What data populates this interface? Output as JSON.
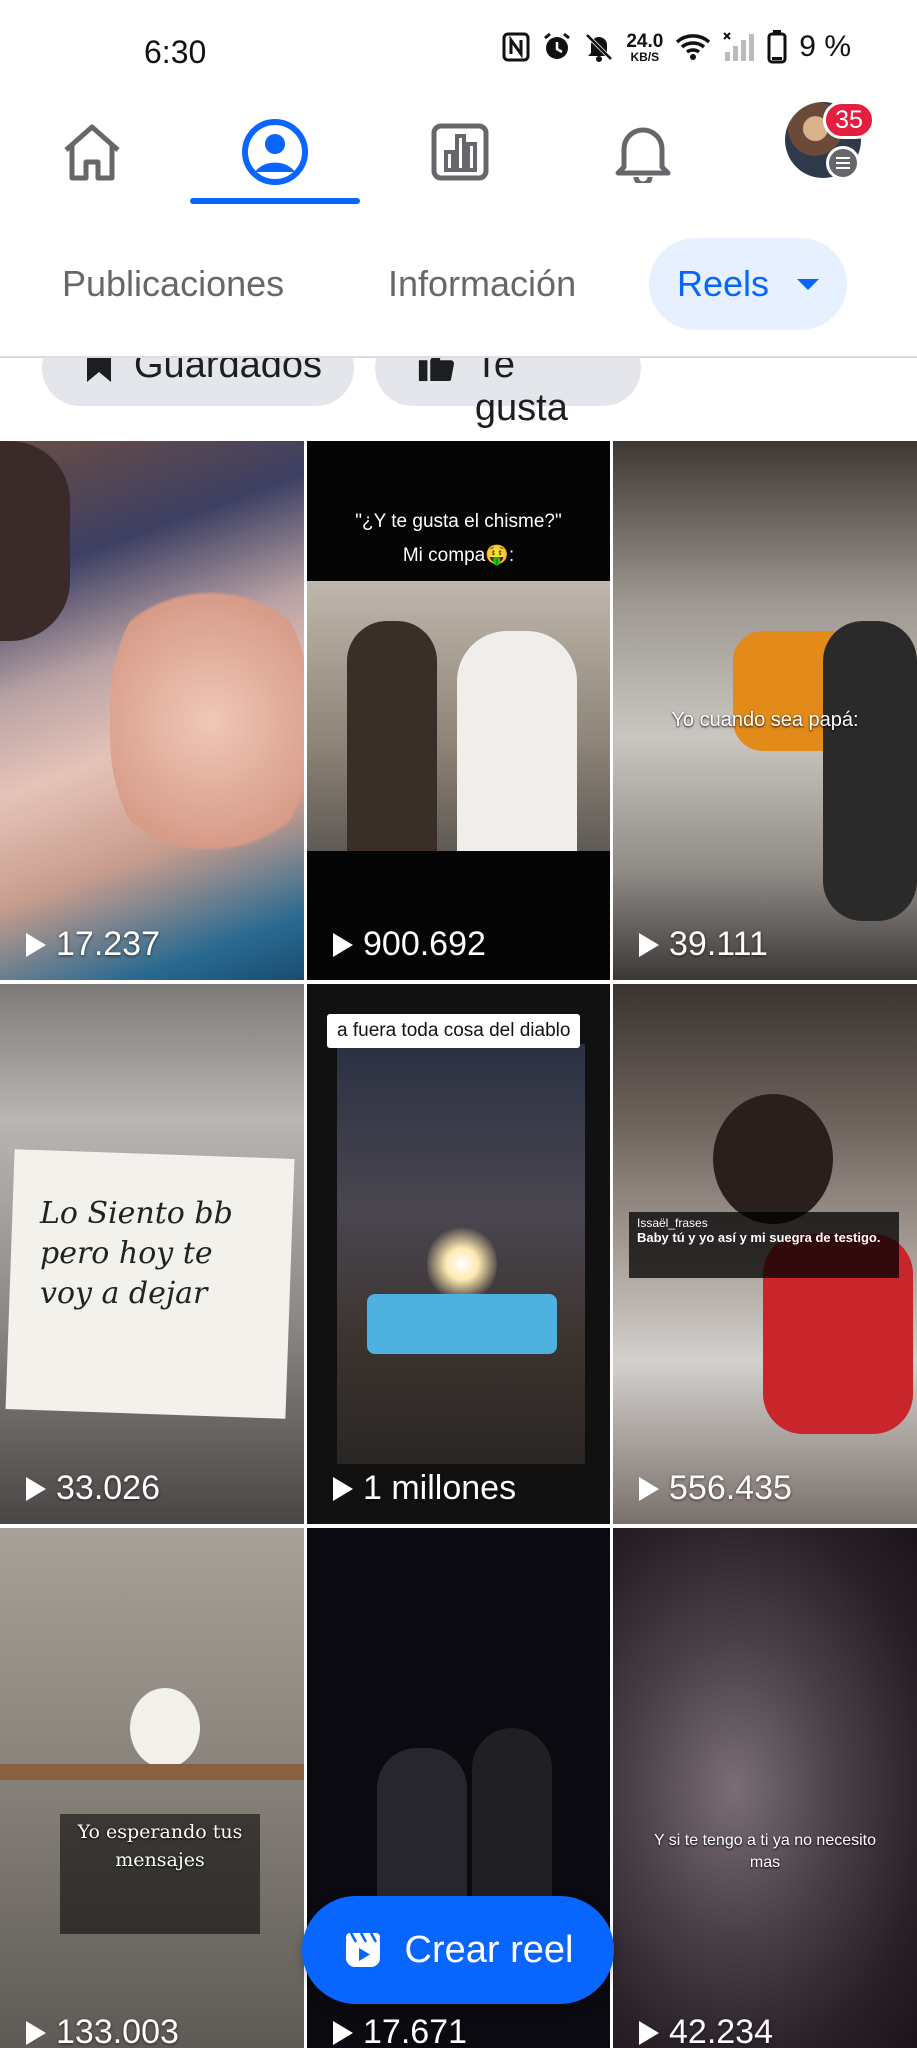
{
  "status_bar": {
    "time": "6:30",
    "net_speed_value": "24.0",
    "net_speed_unit": "KB/S",
    "battery_text": "9 %"
  },
  "nav": {
    "notifications_badge": "35",
    "accent_color": "#0866ff",
    "badge_color": "#e41e3f"
  },
  "tabs": {
    "posts": "Publicaciones",
    "info": "Información",
    "reels": "Reels"
  },
  "filters": {
    "saved": "Guardados",
    "likes": "Te gusta"
  },
  "reels": [
    {
      "views": "17.237",
      "caption": ""
    },
    {
      "views": "900.692",
      "caption": "\"¿Y te gusta el chisme?\"",
      "caption2": "Mi compa🤑:"
    },
    {
      "views": "39.111",
      "caption": "Yo cuando sea papá:"
    },
    {
      "views": "33.026",
      "caption": "Lo Siento bb pero hoy te voy a dejar"
    },
    {
      "views": "1 millones",
      "caption": "a fuera toda cosa del diablo"
    },
    {
      "views": "556.435",
      "caption_user": "Issaël_frases",
      "caption": "Baby tú y yo así y mi suegra de testigo."
    },
    {
      "views": "133.003",
      "caption": "Yo esperando tus mensajes"
    },
    {
      "views": "17.671",
      "caption": ""
    },
    {
      "views": "42.234",
      "caption": "Y si te tengo a ti ya no necesito mas"
    }
  ],
  "fab": {
    "label": "Crear reel"
  }
}
